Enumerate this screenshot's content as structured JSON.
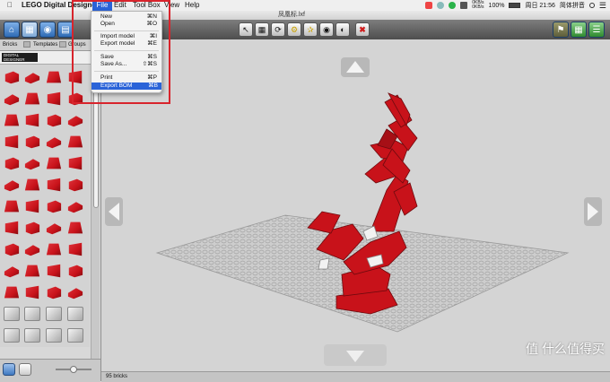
{
  "menubar": {
    "app_name": "LEGO Digital Designer",
    "menus": [
      "File",
      "Edit",
      "Tool Box",
      "View",
      "Help"
    ],
    "status": {
      "net_up": "0KB/s",
      "net_down": "0KB/s",
      "battery": "100%",
      "time": "周日 21:56",
      "input_method": "简体拼音"
    }
  },
  "window": {
    "document_title": "凤凰标.lxf"
  },
  "file_menu": {
    "items": [
      {
        "label": "New",
        "shortcut": "⌘N"
      },
      {
        "label": "Open",
        "shortcut": "⌘O"
      },
      {
        "label": "Import model",
        "shortcut": "⌘I"
      },
      {
        "label": "Export model",
        "shortcut": "⌘E"
      },
      {
        "label": "Save",
        "shortcut": "⌘S"
      },
      {
        "label": "Save As...",
        "shortcut": "⇧⌘S"
      },
      {
        "label": "Print",
        "shortcut": "⌘P"
      },
      {
        "label": "Export BOM",
        "shortcut": "⌘B",
        "selected": true
      }
    ]
  },
  "palette": {
    "tabs": [
      "Bricks",
      "Templates",
      "Groups"
    ],
    "brand_logo": "DIGITAL DESIGNER"
  },
  "status_bar": {
    "brick_count": "95 bricks"
  },
  "watermark": "值 什么值得买",
  "colors": {
    "accent": "#2a63d8",
    "brick_red": "#c8121a",
    "highlight": "#d8242c"
  }
}
